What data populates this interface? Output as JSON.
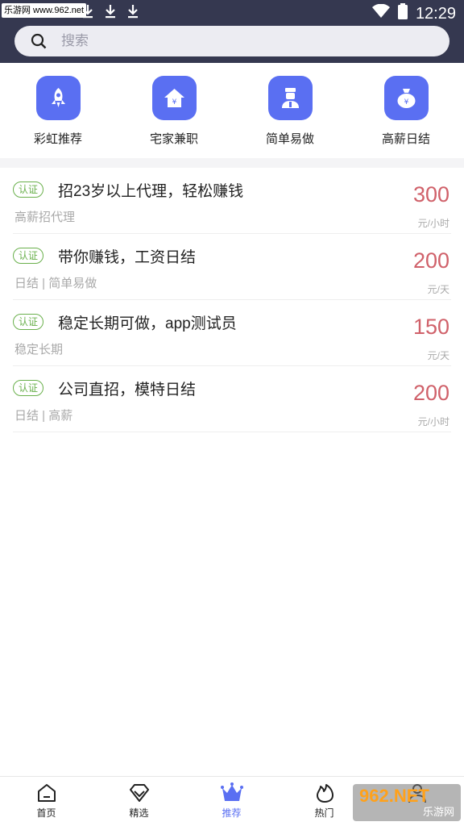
{
  "statusbar": {
    "watermark": "乐游网 www.962.net",
    "time": "12:29"
  },
  "search": {
    "placeholder": "搜索"
  },
  "categories": [
    {
      "label": "彩虹推荐",
      "icon": "rocket-icon"
    },
    {
      "label": "宅家兼职",
      "icon": "house-yen-icon"
    },
    {
      "label": "简单易做",
      "icon": "worker-icon"
    },
    {
      "label": "高薪日结",
      "icon": "money-bag-icon"
    }
  ],
  "jobs": [
    {
      "badge": "认证",
      "title": "招23岁以上代理，轻松赚钱",
      "tags": "高薪招代理",
      "price": "300",
      "unit": "元/小时"
    },
    {
      "badge": "认证",
      "title": "带你赚钱，工资日结",
      "tags": "日结 | 简单易做",
      "price": "200",
      "unit": "元/天"
    },
    {
      "badge": "认证",
      "title": "稳定长期可做，app测试员",
      "tags": "稳定长期",
      "price": "150",
      "unit": "元/天"
    },
    {
      "badge": "认证",
      "title": "公司直招，模特日结",
      "tags": "日结 | 高薪",
      "price": "200",
      "unit": "元/小时"
    }
  ],
  "nav": [
    {
      "label": "首页",
      "icon": "home-icon",
      "active": false
    },
    {
      "label": "精选",
      "icon": "diamond-icon",
      "active": false
    },
    {
      "label": "推荐",
      "icon": "crown-icon",
      "active": true
    },
    {
      "label": "热门",
      "icon": "flame-icon",
      "active": false
    },
    {
      "label": "",
      "icon": "user-icon",
      "active": false
    }
  ],
  "watermark_br": {
    "big": "962.NET",
    "small": "乐游网"
  },
  "colors": {
    "header_bg": "#353850",
    "accent": "#5a6ff2",
    "price": "#d0616a",
    "badge": "#6ab04c"
  }
}
